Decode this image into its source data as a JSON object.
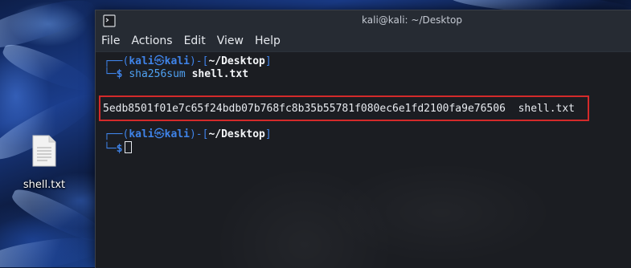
{
  "desktop": {
    "icons": [
      {
        "label": "shell.txt",
        "icon": "text-file-icon"
      }
    ]
  },
  "terminal": {
    "title": "kali@kali: ~/Desktop",
    "app_icon": "terminal-icon",
    "menu": [
      "File",
      "Actions",
      "Edit",
      "View",
      "Help"
    ],
    "prompt1": {
      "open": "┌──(",
      "user": "kali",
      "at": "㉿",
      "host": "kali",
      "mid": ")-[",
      "path": "~/Desktop",
      "close": "]",
      "corner": "└─",
      "dollar": "$",
      "command": "sha256sum",
      "argument": "shell.txt"
    },
    "output": {
      "hash": "5edb8501f01e7c65f24bdb07b768fc8b35b55781f080ec6e1fd2100fa9e76506",
      "filename": "shell.txt"
    },
    "prompt2": {
      "open": "┌──(",
      "user": "kali",
      "at": "㉿",
      "host": "kali",
      "mid": ")-[",
      "path": "~/Desktop",
      "close": "]",
      "corner": "└─",
      "dollar": "$"
    },
    "highlight_color": "#d42a2a"
  }
}
